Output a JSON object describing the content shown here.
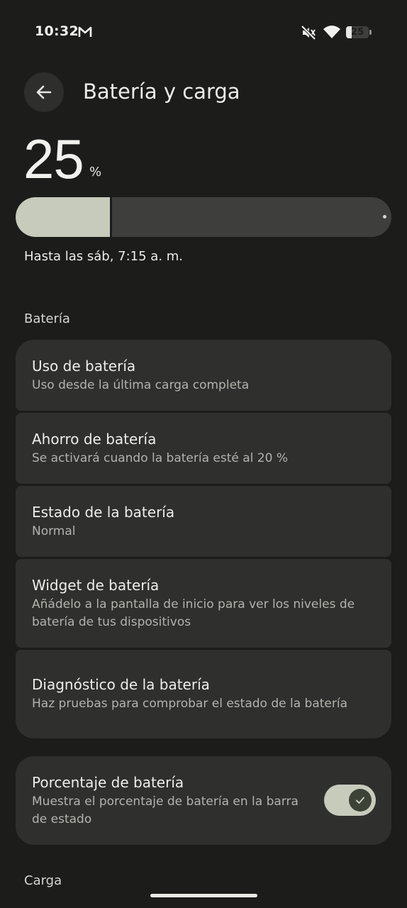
{
  "status_bar": {
    "time": "10:32",
    "battery_level": "25",
    "battery_fraction": 0.25,
    "icons": [
      "gmail-icon",
      "mute-icon",
      "wifi-icon",
      "battery-icon"
    ]
  },
  "header": {
    "title": "Batería y carga",
    "back_icon": "arrow-back-icon"
  },
  "battery": {
    "level_value": "25",
    "level_unit": "%",
    "level_fraction": 0.25,
    "estimate": "Hasta las sáb, 7:15 a. m."
  },
  "sections": {
    "battery_label": "Batería",
    "charging_label": "Carga"
  },
  "items": [
    {
      "title": "Uso de batería",
      "subtitle": "Uso desde la última carga completa"
    },
    {
      "title": "Ahorro de batería",
      "subtitle": "Se activará cuando la batería esté al 20 %"
    },
    {
      "title": "Estado de la batería",
      "subtitle": "Normal"
    },
    {
      "title": "Widget de batería",
      "subtitle": "Añádelo a la pantalla de inicio para ver los niveles de batería de tus dispositivos"
    },
    {
      "title": "Diagnóstico de la batería",
      "subtitle": "Haz pruebas para comprobar el estado de la batería"
    }
  ],
  "percentage_toggle": {
    "title": "Porcentaje de batería",
    "subtitle": "Muestra el porcentaje de batería en la barra de estado",
    "checked": true,
    "icon": "check-icon"
  },
  "colors": {
    "background": "#1c1c1b",
    "card": "#2f302d",
    "accent": "#c6cbbc"
  }
}
